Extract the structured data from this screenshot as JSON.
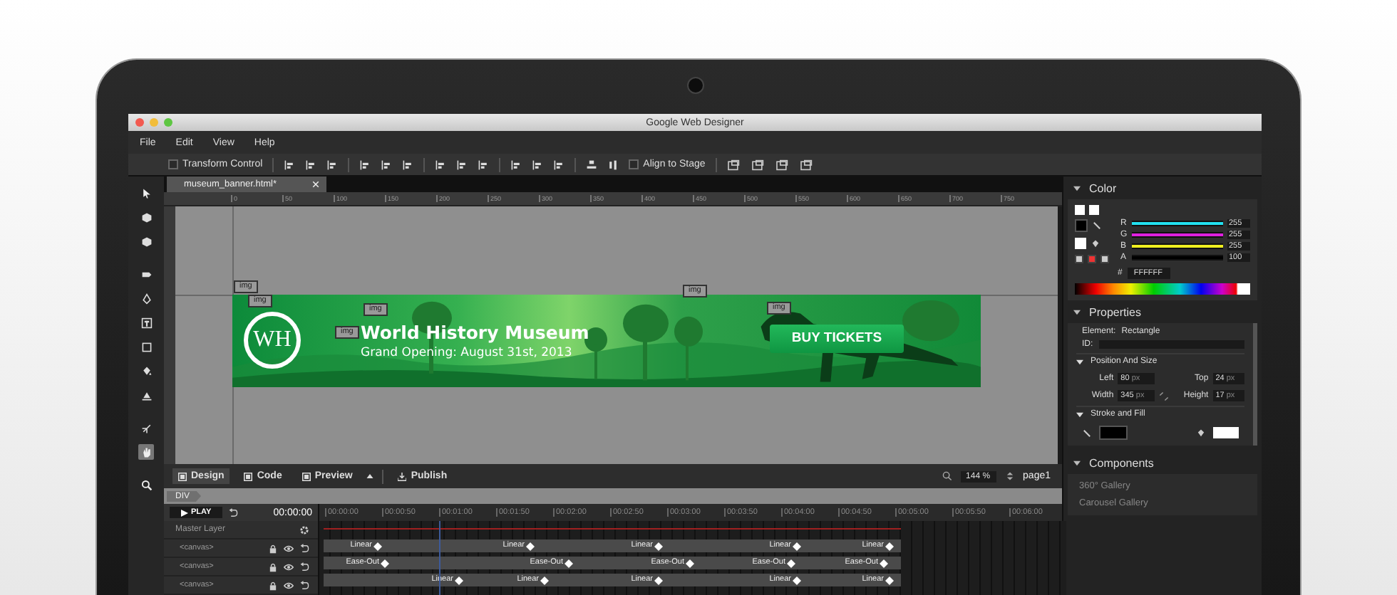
{
  "window": {
    "title": "Google Web Designer"
  },
  "menu": [
    "File",
    "Edit",
    "View",
    "Help"
  ],
  "toolbar": {
    "transform_control": {
      "label": "Transform Control",
      "checked": false
    },
    "align_to_stage": {
      "label": "Align to Stage",
      "checked": false
    }
  },
  "tools": [
    {
      "kind": "select",
      "selected": false
    },
    {
      "kind": "rotate",
      "selected": false
    },
    {
      "kind": "translate",
      "selected": false
    },
    {
      "kind": "tag",
      "selected": false
    },
    {
      "kind": "pen",
      "selected": false
    },
    {
      "kind": "text",
      "selected": false
    },
    {
      "kind": "shape",
      "selected": false
    },
    {
      "kind": "bucket",
      "selected": false
    },
    {
      "kind": "fill",
      "selected": false
    },
    {
      "kind": "bone",
      "selected": false
    },
    {
      "kind": "hand",
      "selected": true
    },
    {
      "kind": "zoom",
      "selected": false
    }
  ],
  "document_tab": {
    "label": "museum_banner.html*"
  },
  "ruler": [
    "0",
    "50",
    "100",
    "150",
    "200",
    "250",
    "300",
    "350",
    "400",
    "450",
    "500",
    "550",
    "600",
    "650",
    "700",
    "750"
  ],
  "banner": {
    "logo": "WH",
    "title": "World History Museum",
    "subtitle": "Grand Opening: August 31st, 2013",
    "button": "BUY TICKETS",
    "image_tags": [
      "img",
      "img",
      "img",
      "img",
      "img",
      "img"
    ]
  },
  "bottom_bar": {
    "modes": [
      {
        "label": "Design",
        "selected": true
      },
      {
        "label": "Code",
        "selected": false
      },
      {
        "label": "Preview",
        "selected": false
      }
    ],
    "publish": "Publish",
    "zoom": "144 %",
    "page": "page1"
  },
  "breadcrumb": "DIV",
  "timeline": {
    "play": "PLAY",
    "time": "00:00:00",
    "master_layer": "Master Layer",
    "ticks": [
      "00:00:00",
      "00:00:50",
      "00:01:00",
      "00:01:50",
      "00:02:00",
      "00:02:50",
      "00:03:00",
      "00:03:50",
      "00:04:00",
      "00:04:50",
      "00:05:00",
      "00:05:50",
      "00:06:00"
    ],
    "layers": [
      {
        "name": "<canvas>",
        "keyframes": [
          "Linear",
          "Linear",
          "Linear",
          "Linear",
          "Linear"
        ]
      },
      {
        "name": "<canvas>",
        "keyframes": [
          "Ease-Out",
          "Ease-Out",
          "Ease-Out",
          "Ease-Out",
          "Ease-Out"
        ]
      },
      {
        "name": "<canvas>",
        "keyframes": [
          "Linear",
          "Linear",
          "Linear",
          "Linear",
          "Linear"
        ]
      }
    ]
  },
  "color": {
    "title": "Color",
    "expanded": true,
    "channels": [
      {
        "name": "R",
        "level": 1,
        "value": "255",
        "color": "#22e0f0"
      },
      {
        "name": "G",
        "level": 1,
        "value": "255",
        "color": "#e020e0"
      },
      {
        "name": "B",
        "level": 1,
        "value": "255",
        "color": "#f0f020"
      },
      {
        "name": "A",
        "level": 1,
        "value": "100",
        "color": "#000000"
      }
    ],
    "hex_label": "#",
    "hex": "FFFFFF"
  },
  "properties": {
    "title": "Properties",
    "expanded": true,
    "element_label": "Element:",
    "element": "Rectangle",
    "id_label": "ID:",
    "position": {
      "title": "Position And Size",
      "expanded": true,
      "fields": [
        {
          "label": "Left",
          "value": "80",
          "unit": "px"
        },
        {
          "label": "Top",
          "value": "24",
          "unit": "px"
        },
        {
          "label": "Width",
          "value": "345",
          "unit": "px"
        },
        {
          "label": "Height",
          "value": "17",
          "unit": "px"
        }
      ]
    },
    "stroke_fill": {
      "title": "Stroke and Fill",
      "expanded": true
    }
  },
  "components": {
    "title": "Components",
    "expanded": true,
    "items": [
      "360° Gallery",
      "Carousel Gallery"
    ]
  }
}
